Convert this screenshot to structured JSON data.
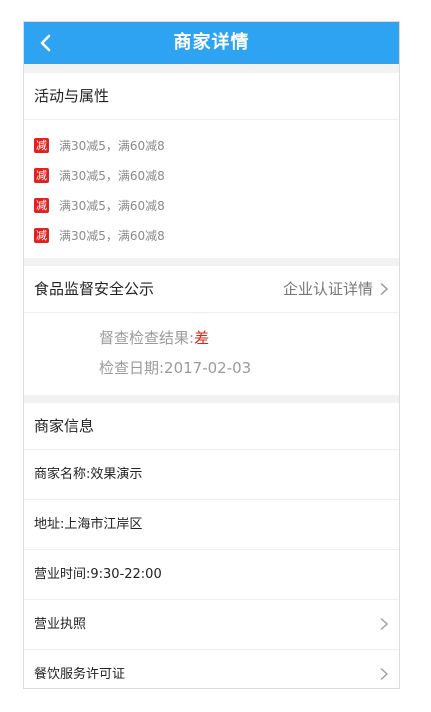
{
  "header": {
    "title": "商家详情",
    "back_icon": "chevron-left-icon",
    "bg_color": "#2ea3f2"
  },
  "activities": {
    "title": "活动与属性",
    "badge_label": "减",
    "badge_color": "#e3211c",
    "items": [
      "满30减5，满60减8",
      "满30减5，满60减8",
      "满30减5，满60减8",
      "满30减5，满60减8"
    ]
  },
  "food_safety": {
    "title": "食品监督安全公示",
    "link_label": "企业认证详情",
    "result_label": "督查检查结果:",
    "result_value": "差",
    "date_text": "检查日期:2017-02-03"
  },
  "merchant": {
    "title": "商家信息",
    "name": "商家名称:效果演示",
    "address": "地址:上海市江岸区",
    "hours": "营业时间:9:30-22:00",
    "license": "营业执照",
    "permit": "餐饮服务许可证"
  }
}
